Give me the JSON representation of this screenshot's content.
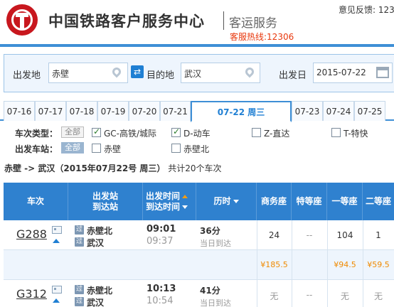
{
  "header": {
    "title": "中国铁路客户服务中心",
    "subtitle": "客运服务",
    "hotline": "客服热线:12306",
    "feedback": "意见反馈: 123"
  },
  "search": {
    "from_label": "出发地",
    "from_value": "赤壁",
    "to_label": "目的地",
    "to_value": "武汉",
    "date_label": "出发日",
    "date_value": "2015-07-22"
  },
  "date_tabs": [
    "07-16",
    "07-17",
    "07-18",
    "07-19",
    "07-20",
    "07-21",
    "07-22 周三",
    "07-23",
    "07-24",
    "07-25"
  ],
  "filters": {
    "type_label": "车次类型：",
    "station_label": "出发车站：",
    "all_label": "全部",
    "types": [
      {
        "label": "GC-高铁/城际",
        "checked": true
      },
      {
        "label": "D-动车",
        "checked": true
      },
      {
        "label": "Z-直达",
        "checked": false
      },
      {
        "label": "T-特快",
        "checked": false
      }
    ],
    "stations": [
      {
        "label": "赤壁",
        "checked": false
      },
      {
        "label": "赤壁北",
        "checked": false
      }
    ]
  },
  "summary": {
    "route": "赤壁 -> 武汉（2015年07月22号  周三）",
    "count": "共计20个车次"
  },
  "table": {
    "headers": {
      "train": "车次",
      "station_1": "出发站",
      "station_2": "到达站",
      "time_1": "出发时间",
      "time_2": "到达时间",
      "duration": "历时",
      "business": "商务座",
      "special": "特等座",
      "first": "一等座",
      "second": "二等座"
    },
    "rows": [
      {
        "train": "G288",
        "from_badge": "过",
        "to_badge": "过",
        "from_station": "赤壁北",
        "to_station": "武汉",
        "depart": "09:01",
        "arrive": "09:37",
        "duration": "36分",
        "duration_note": "当日到达",
        "business": "24",
        "special": "--",
        "first": "104",
        "second": "1",
        "price_business": "¥185.5",
        "price_first": "¥94.5",
        "price_second": "¥59.5"
      },
      {
        "train": "G312",
        "from_badge": "过",
        "to_badge": "过",
        "from_station": "赤壁北",
        "to_station": "武汉",
        "depart": "10:13",
        "arrive": "10:54",
        "duration": "41分",
        "duration_note": "当日到达",
        "business": "无",
        "special": "--",
        "first": "无",
        "second": "无"
      }
    ]
  },
  "colors": {
    "accent": "#2f81cf",
    "brand_red": "#c8171e",
    "price": "#f08a00"
  }
}
